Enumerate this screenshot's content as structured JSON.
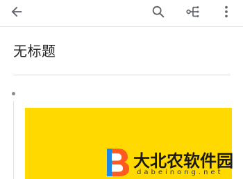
{
  "appbar": {
    "back_icon": "arrow-back-icon",
    "search_icon": "search-icon",
    "mindmap_icon": "mind-map-icon",
    "more_icon": "more-vert-icon"
  },
  "document": {
    "title": "无标题"
  },
  "outline": {
    "bullet_icon": "bullet-dot-icon"
  },
  "image_block": {
    "color": "#ffd900"
  },
  "watermark": {
    "name": "大北农软件园",
    "domain": "dabeinong.net"
  },
  "colors": {
    "accent_yellow": "#ffd900",
    "icon_gray": "#5f6368",
    "text": "#212121"
  }
}
